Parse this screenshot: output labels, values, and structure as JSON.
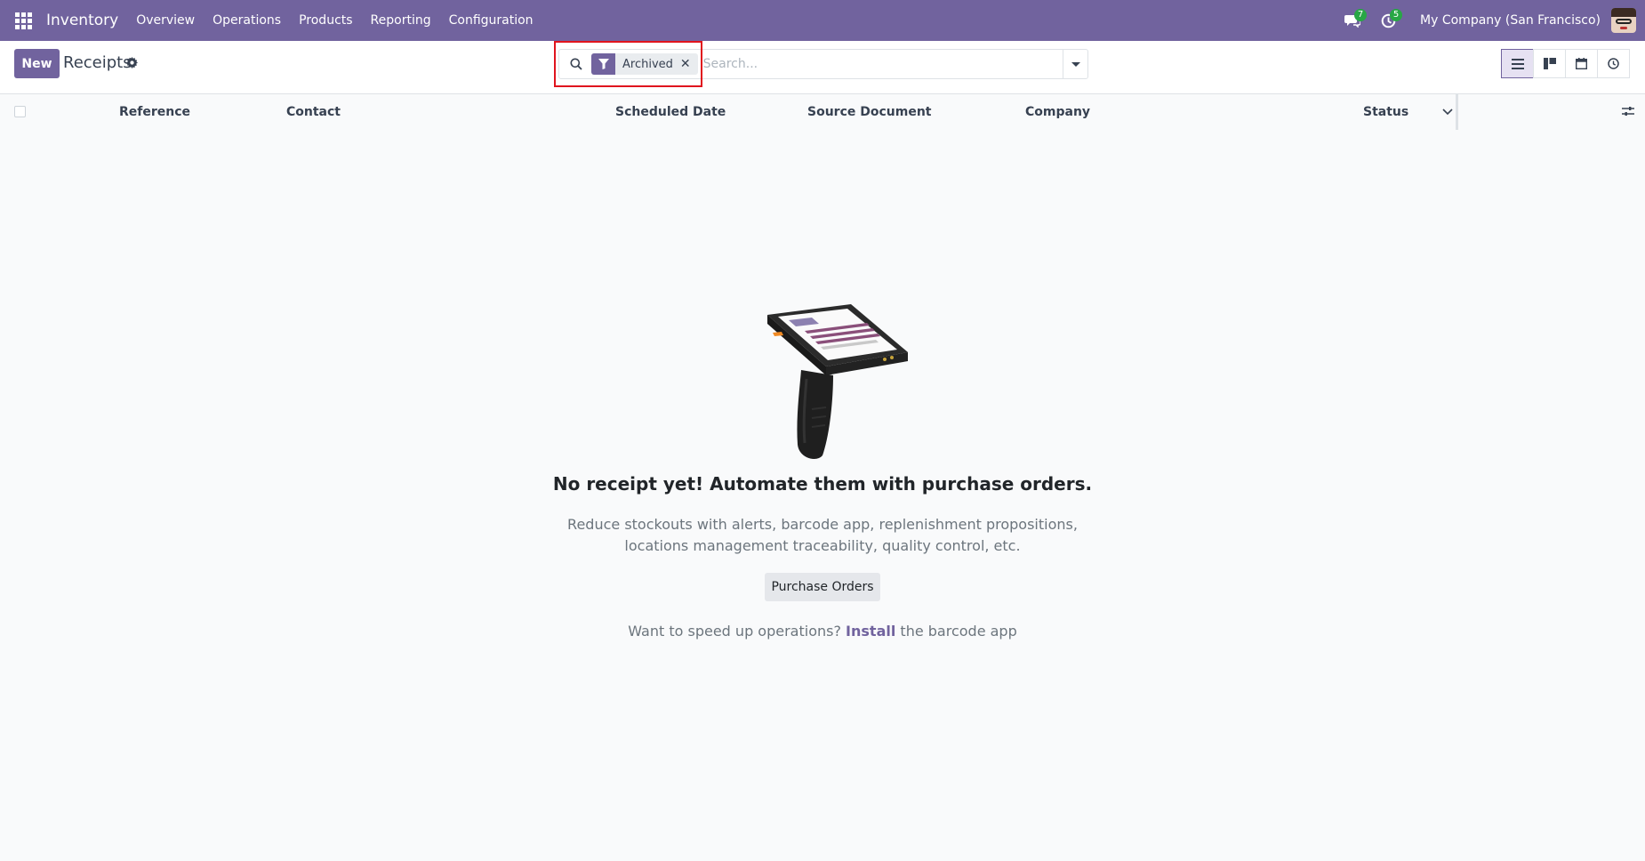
{
  "navbar": {
    "brand": "Inventory",
    "menu": [
      "Overview",
      "Operations",
      "Products",
      "Reporting",
      "Configuration"
    ],
    "messages_badge": "7",
    "activities_badge": "5",
    "company": "My Company (San Francisco)"
  },
  "control": {
    "new_label": "New",
    "title": "Receipts",
    "search": {
      "facet_label": "Archived",
      "facet_close": "✕",
      "placeholder": "Search..."
    }
  },
  "columns": [
    "Reference",
    "Contact",
    "Scheduled Date",
    "Source Document",
    "Company",
    "Status"
  ],
  "empty": {
    "title": "No receipt yet! Automate them with purchase orders.",
    "description": "Reduce stockouts with alerts, barcode app, replenishment propositions, locations management traceability, quality control, etc.",
    "button_label": "Purchase Orders",
    "install_prefix": "Want to speed up operations?",
    "install_link": "Install",
    "install_suffix": "the barcode app"
  },
  "colors": {
    "brand": "#71639e",
    "badge": "#28a745",
    "highlight": "#e0141e"
  }
}
